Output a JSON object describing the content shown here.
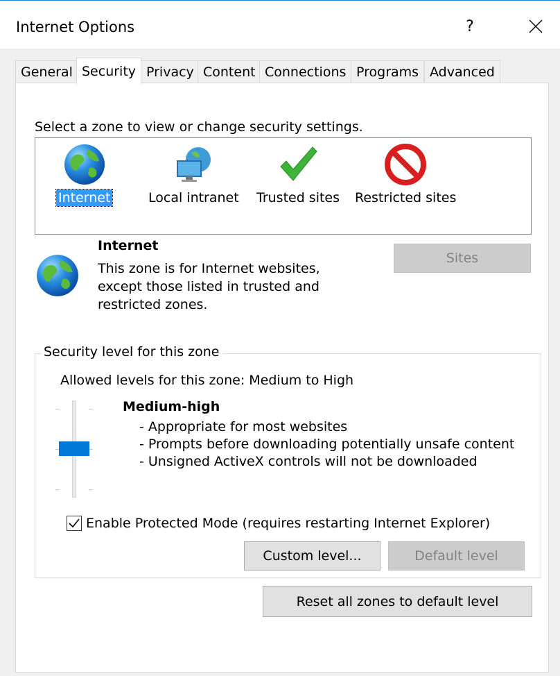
{
  "window": {
    "title": "Internet Options",
    "help": "?"
  },
  "tabs": [
    {
      "label": "General"
    },
    {
      "label": "Security",
      "active": true
    },
    {
      "label": "Privacy"
    },
    {
      "label": "Content"
    },
    {
      "label": "Connections"
    },
    {
      "label": "Programs"
    },
    {
      "label": "Advanced"
    }
  ],
  "zones": {
    "prompt": "Select a zone to view or change security settings.",
    "items": [
      {
        "label": "Internet",
        "icon": "globe-icon",
        "selected": true
      },
      {
        "label": "Local intranet",
        "icon": "intranet-icon"
      },
      {
        "label": "Trusted sites",
        "icon": "checkmark-icon"
      },
      {
        "label": "Restricted sites",
        "icon": "prohibited-icon"
      }
    ]
  },
  "zone_info": {
    "title": "Internet",
    "description_lines": [
      "This zone is for Internet websites,",
      "except those listed in trusted and",
      "restricted zones."
    ],
    "sites_label": "Sites"
  },
  "security_level": {
    "legend": "Security level for this zone",
    "allowed": "Allowed levels for this zone: Medium to High",
    "level_name": "Medium-high",
    "bullets": [
      "- Appropriate for most websites",
      "- Prompts before downloading potentially unsafe content",
      "- Unsigned ActiveX controls will not be downloaded"
    ],
    "protected_mode_label": "Enable Protected Mode (requires restarting Internet Explorer)",
    "protected_mode_checked": true,
    "custom_label": "Custom level...",
    "default_label": "Default level"
  },
  "reset_label": "Reset all zones to default level",
  "colors": {
    "accent": "#0078d7",
    "selection": "#3399ff"
  }
}
